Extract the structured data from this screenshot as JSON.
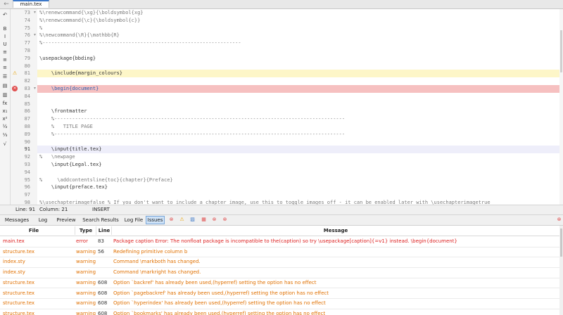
{
  "tabs": {
    "file_tab": "main.tex",
    "back_arrow": "←"
  },
  "toolbar": {
    "items": [
      {
        "name": "undo-icon",
        "glyph": "↶"
      },
      {
        "name": "bold-icon",
        "glyph": "B"
      },
      {
        "name": "italic-icon",
        "glyph": "I"
      },
      {
        "name": "underline-icon",
        "glyph": "U"
      },
      {
        "name": "align-left-icon",
        "glyph": "≡"
      },
      {
        "name": "align-center-icon",
        "glyph": "≡"
      },
      {
        "name": "align-right-icon",
        "glyph": "≡"
      },
      {
        "name": "list-icon",
        "glyph": "☰"
      },
      {
        "name": "frame-icon",
        "glyph": "▤"
      },
      {
        "name": "note-icon",
        "glyph": "▥"
      },
      {
        "name": "function-icon",
        "glyph": "fx"
      },
      {
        "name": "subscript-icon",
        "glyph": "x₁"
      },
      {
        "name": "superscript-icon",
        "glyph": "x²"
      },
      {
        "name": "fraction-icon",
        "glyph": "½"
      },
      {
        "name": "fraction-alt-icon",
        "glyph": "⅓"
      },
      {
        "name": "sqrt-icon",
        "glyph": "√"
      }
    ]
  },
  "editor": {
    "lines": [
      {
        "n": "73",
        "text": "%\\renewcommand{\\xg}{\\boldsymbol{xg}",
        "cls": "comment",
        "fold": true
      },
      {
        "n": "74",
        "text": "%\\renewcommand{\\c}{\\boldsymbol{c}}",
        "cls": "comment"
      },
      {
        "n": "75",
        "text": "%",
        "cls": "comment"
      },
      {
        "n": "76",
        "text": "%\\newcommand{\\R}{\\mathbb{R}",
        "cls": "comment",
        "fold": true
      },
      {
        "n": "77",
        "text": "%-------------------------------------------------------------------",
        "cls": "comment"
      },
      {
        "n": "78",
        "text": "",
        "cls": "code"
      },
      {
        "n": "79",
        "text": "\\usepackage{bbding}",
        "cls": "code"
      },
      {
        "n": "80",
        "text": "",
        "cls": "code"
      },
      {
        "n": "81",
        "text": "    \\include{margin_colours}",
        "cls": "code warnline",
        "mark": "warn"
      },
      {
        "n": "82",
        "text": "",
        "cls": "code"
      },
      {
        "n": "83",
        "text": "    \\begin{document}",
        "cls": "begin errline",
        "mark": "error",
        "fold": true
      },
      {
        "n": "84",
        "text": "",
        "cls": "code"
      },
      {
        "n": "85",
        "text": "",
        "cls": "code"
      },
      {
        "n": "86",
        "text": "    \\frontmatter",
        "cls": "code"
      },
      {
        "n": "87",
        "text": "    %--------------------------------------------------------------------------------------------------",
        "cls": "comment"
      },
      {
        "n": "88",
        "text": "    %   TITLE PAGE",
        "cls": "comment"
      },
      {
        "n": "89",
        "text": "    %--------------------------------------------------------------------------------------------------",
        "cls": "comment"
      },
      {
        "n": "90",
        "text": "",
        "cls": "code"
      },
      {
        "n": "91",
        "text": "    \\input{title.tex}",
        "cls": "code curline",
        "current": true
      },
      {
        "n": "92",
        "text": "%   \\newpage",
        "cls": "comment"
      },
      {
        "n": "93",
        "text": "    \\input{Legal.tex}",
        "cls": "code"
      },
      {
        "n": "94",
        "text": "",
        "cls": "code"
      },
      {
        "n": "95",
        "text": "%     \\addcontentsline{toc}{chapter}{Preface}",
        "cls": "comment"
      },
      {
        "n": "96",
        "text": "    \\input{preface.tex}",
        "cls": "code"
      },
      {
        "n": "97",
        "text": "",
        "cls": "code"
      },
      {
        "n": "98",
        "text": "%\\usechapterimagefalse % If you don't want to include a chapter image, use this to toggle images off - it can be enabled later with \\usechapterimagetrue",
        "cls": "comment"
      }
    ]
  },
  "status": {
    "line": "Line: 91",
    "column": "Column: 21",
    "mode": "INSERT"
  },
  "bottom_tabs": [
    "Messages",
    "Log",
    "Preview",
    "Search Results",
    "Log File",
    "Issues"
  ],
  "bottom_selected": "Issues",
  "filter_buttons": [
    {
      "name": "error-filter-icon",
      "glyph": "⊗",
      "color": "#e05050"
    },
    {
      "name": "warning-filter-icon",
      "glyph": "⚠",
      "color": "#e8a200"
    },
    {
      "name": "badbox-filter-icon",
      "glyph": "▨",
      "color": "#3c78c8"
    },
    {
      "name": "combined-filter-icon",
      "glyph": "▦",
      "color": "#e05050"
    },
    {
      "name": "clear-error-icon",
      "glyph": "⊗",
      "color": "#e05050"
    },
    {
      "name": "clear-all-icon",
      "glyph": "⊗",
      "color": "#e05050"
    }
  ],
  "issues": {
    "headers": {
      "file": "File",
      "type": "Type",
      "line": "Line",
      "message": "Message"
    },
    "rows": [
      {
        "file": "main.tex",
        "type": "error",
        "line": "83",
        "message": "Package caption Error: The nonfloat package is incompatible to the(caption) so try \\usepackage[caption]{=v1} instead. \\begin{document}"
      },
      {
        "file": "structure.tex",
        "type": "warning",
        "line": "56",
        "message": "Redefining primitive column b"
      },
      {
        "file": "index.sty",
        "type": "warning",
        "line": "",
        "message": "Command \\markboth has changed."
      },
      {
        "file": "index.sty",
        "type": "warning",
        "line": "",
        "message": "Command \\markright has changed."
      },
      {
        "file": "structure.tex",
        "type": "warning",
        "line": "608",
        "message": "Option `backref' has already been used,(hyperref) setting the option has no effect"
      },
      {
        "file": "structure.tex",
        "type": "warning",
        "line": "608",
        "message": "Option `pagebackref' has already been used,(hyperref) setting the option has no effect"
      },
      {
        "file": "structure.tex",
        "type": "warning",
        "line": "608",
        "message": "Option `hyperindex' has already been used,(hyperref) setting the option has no effect"
      },
      {
        "file": "structure.tex",
        "type": "warning",
        "line": "608",
        "message": "Option `bookmarks' has already been used,(hyperref) setting the option has no effect"
      }
    ]
  },
  "panel_close_glyph": "⊗"
}
